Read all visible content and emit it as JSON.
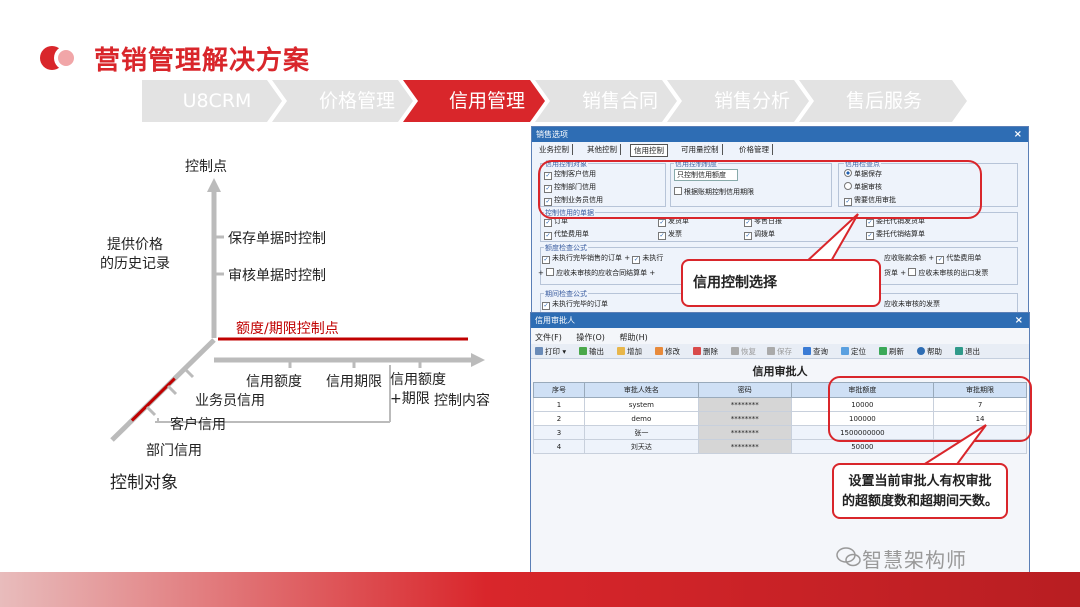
{
  "header": {
    "title": "营销管理解决方案"
  },
  "breadcrumb": {
    "items": [
      {
        "label": "U8CRM",
        "active": false
      },
      {
        "label": "价格管理",
        "active": false
      },
      {
        "label": "信用管理",
        "active": true
      },
      {
        "label": "销售合同",
        "active": false
      },
      {
        "label": "销售分析",
        "active": false
      },
      {
        "label": "售后服务",
        "active": false
      }
    ]
  },
  "diagram": {
    "axis_top": "控制点",
    "history": "提供价格\n的历史记录",
    "save_ctrl": "保存单据时控制",
    "audit_ctrl": "审核单据时控制",
    "limit_ctrl": "额度/期限控制点",
    "amount": "信用额度",
    "period": "信用期限",
    "amount_period": "信用额度+期限",
    "content": "控制内容",
    "sales_credit": "业务员信用",
    "customer_credit": "客户信用",
    "dept_credit": "部门信用",
    "object": "控制对象"
  },
  "win1": {
    "title": "销售选项",
    "tabs": [
      "业务控制",
      "其他控制",
      "信用控制",
      "可用量控制",
      "价格管理"
    ],
    "grp_object": "信用控制对象",
    "grp_system": "信用控制制度",
    "grp_prompt": "信用检查点",
    "obj_items": [
      "控制客户信用",
      "控制部门信用",
      "控制业务员信用"
    ],
    "system_select": "只控制信用额度",
    "system_check": "根据账期控制信用期限",
    "prompt_items": [
      "单据保存",
      "单据审核"
    ],
    "prompt_check": "需要信用审批",
    "grp_docs": "控制信用的单据",
    "docs": [
      "订单",
      "发货单",
      "零售日报",
      "委托代销发货单",
      "代垫费用单",
      "发票",
      "调拨单",
      "委托代销结算单"
    ],
    "grp_formula": "额度检查公式",
    "formula1": "未执行完毕销售的订单",
    "formula1b": "未执行",
    "formula2": "应收未审核的应收合同结算单",
    "formula3": "应收账款余额",
    "formula4": "代垫费用单",
    "formula5": "货单",
    "formula6": "应收未审核的出口发票",
    "grp_period": "期间检查公式",
    "period1": "未执行完毕的订单",
    "period2": "应收未审核的发票"
  },
  "win2": {
    "title": "信用审批人",
    "menus": [
      "文件(F)",
      "操作(O)",
      "帮助(H)"
    ],
    "toolbar": [
      "打印",
      "输出",
      "增加",
      "修改",
      "删除",
      "恢复",
      "保存",
      "查询",
      "定位",
      "刷新",
      "帮助",
      "退出"
    ],
    "grid_title": "信用审批人",
    "columns": [
      "序号",
      "审批人姓名",
      "密码",
      "审批额度",
      "审批期限"
    ],
    "rows": [
      [
        "1",
        "system",
        "********",
        "10000",
        "7"
      ],
      [
        "2",
        "demo",
        "********",
        "100000",
        "14"
      ],
      [
        "3",
        "张一",
        "********",
        "1500000000",
        ""
      ],
      [
        "4",
        "刘天达",
        "********",
        "50000",
        ""
      ]
    ]
  },
  "callouts": {
    "credit_select": "信用控制选择",
    "approver_note_1": "设置当前审批人有权审批",
    "approver_note_2": "的超额度数和超期间天数。"
  },
  "footer": {
    "brand": "智慧架构师"
  },
  "colors": {
    "accent": "#d9262b",
    "crumb_grey": "#e3e3e3",
    "window_title": "#2e6db4"
  }
}
